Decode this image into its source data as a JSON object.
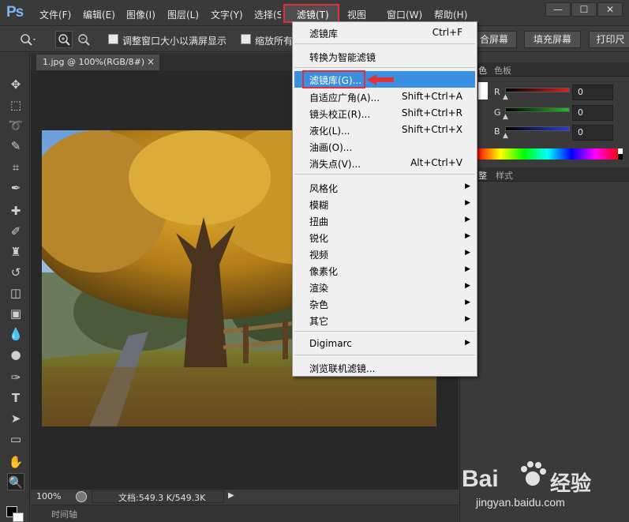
{
  "app": {
    "logo": "Ps"
  },
  "menubar": {
    "items": [
      "文件(F)",
      "编辑(E)",
      "图像(I)",
      "图层(L)",
      "文字(Y)",
      "选择(S)",
      "滤镜(T)",
      "视图",
      "窗口(W)",
      "帮助(H)"
    ],
    "window_buttons": [
      "—",
      "☐",
      "✕"
    ]
  },
  "options_bar": {
    "check1_label": "调整窗口大小以满屏显示",
    "check2_label": "缩放所有",
    "btn_fit": "合屏幕",
    "btn_fill": "填充屏幕",
    "btn_print": "打印尺"
  },
  "document": {
    "tab_label": "1.jpg @ 100%(RGB/8#)",
    "tab_close": "×",
    "zoom": "100%",
    "doc_info": "文档:549.3 K/549.3K",
    "timeline_label": "时间轴"
  },
  "color_panel": {
    "tab1": "色",
    "tab2": "色板",
    "channels": [
      {
        "name": "R",
        "value": "0",
        "color": "#e02020"
      },
      {
        "name": "G",
        "value": "0",
        "color": "#20c020"
      },
      {
        "name": "B",
        "value": "0",
        "color": "#2040e0"
      }
    ],
    "lower_tab1": "整",
    "lower_tab2": "样式"
  },
  "filter_menu": {
    "items": [
      {
        "label": "滤镜库",
        "shortcut": "Ctrl+F"
      },
      {
        "label": "转换为智能滤镜",
        "shortcut": ""
      },
      {
        "label": "滤镜库(G)...",
        "shortcut": "",
        "highlighted": true
      },
      {
        "label": "自适应广角(A)...",
        "shortcut": "Shift+Ctrl+A"
      },
      {
        "label": "镜头校正(R)...",
        "shortcut": "Shift+Ctrl+R"
      },
      {
        "label": "液化(L)...",
        "shortcut": "Shift+Ctrl+X"
      },
      {
        "label": "油画(O)...",
        "shortcut": ""
      },
      {
        "label": "消失点(V)...",
        "shortcut": "Alt+Ctrl+V"
      },
      {
        "label": "风格化",
        "submenu": true
      },
      {
        "label": "模糊",
        "submenu": true
      },
      {
        "label": "扭曲",
        "submenu": true
      },
      {
        "label": "锐化",
        "submenu": true
      },
      {
        "label": "视频",
        "submenu": true
      },
      {
        "label": "像素化",
        "submenu": true
      },
      {
        "label": "渲染",
        "submenu": true
      },
      {
        "label": "杂色",
        "submenu": true
      },
      {
        "label": "其它",
        "submenu": true
      },
      {
        "label": "Digimarc",
        "submenu": true
      },
      {
        "label": "浏览联机滤镜...",
        "shortcut": ""
      }
    ]
  },
  "watermark": {
    "brand": "Bai",
    "brand2": "经验",
    "url": "jingyan.baidu.com"
  },
  "colors": {
    "accent_highlight": "#3b8fe0",
    "annotation_red": "#e0303a"
  }
}
